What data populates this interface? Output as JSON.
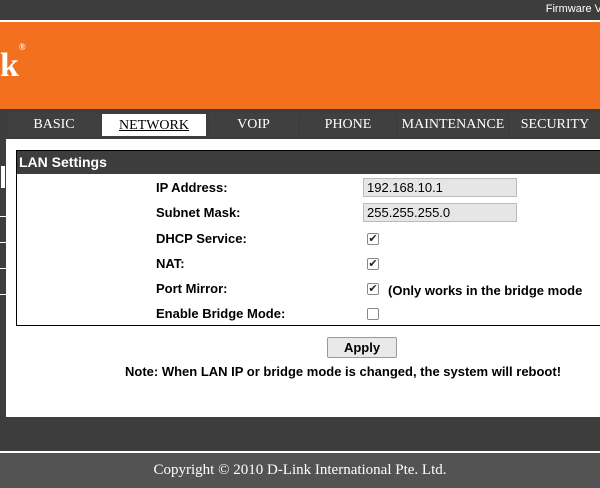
{
  "header": {
    "firmware_label": "Firmware V",
    "logo_text": "k",
    "logo_mark": "®"
  },
  "nav": {
    "tabs": [
      {
        "label": "BASIC"
      },
      {
        "label": "NETWORK",
        "active": true
      },
      {
        "label": "VOIP"
      },
      {
        "label": "PHONE"
      },
      {
        "label": "MAINTENANCE"
      },
      {
        "label": "SECURITY"
      }
    ]
  },
  "lan_settings": {
    "title": "LAN Settings",
    "ip_address": {
      "label": "IP Address:",
      "value": "192.168.10.1"
    },
    "subnet_mask": {
      "label": "Subnet Mask:",
      "value": "255.255.255.0"
    },
    "dhcp_service": {
      "label": "DHCP Service:",
      "checked": true,
      "mark": "✔"
    },
    "nat": {
      "label": "NAT:",
      "checked": true,
      "mark": "✔"
    },
    "port_mirror": {
      "label": "Port Mirror:",
      "checked": true,
      "mark": "✔",
      "note": "(Only works in the bridge mode"
    },
    "bridge_mode": {
      "label": "Enable Bridge Mode:",
      "checked": false,
      "mark": ""
    }
  },
  "actions": {
    "apply_label": "Apply"
  },
  "note": "Note: When LAN IP or bridge mode is changed, the system will reboot!",
  "footer": {
    "copyright": "Copyright © 2010 D-Link International Pte. Ltd."
  },
  "colors": {
    "brand_orange": "#f2701e",
    "dark_gray": "#3d3d3d"
  }
}
